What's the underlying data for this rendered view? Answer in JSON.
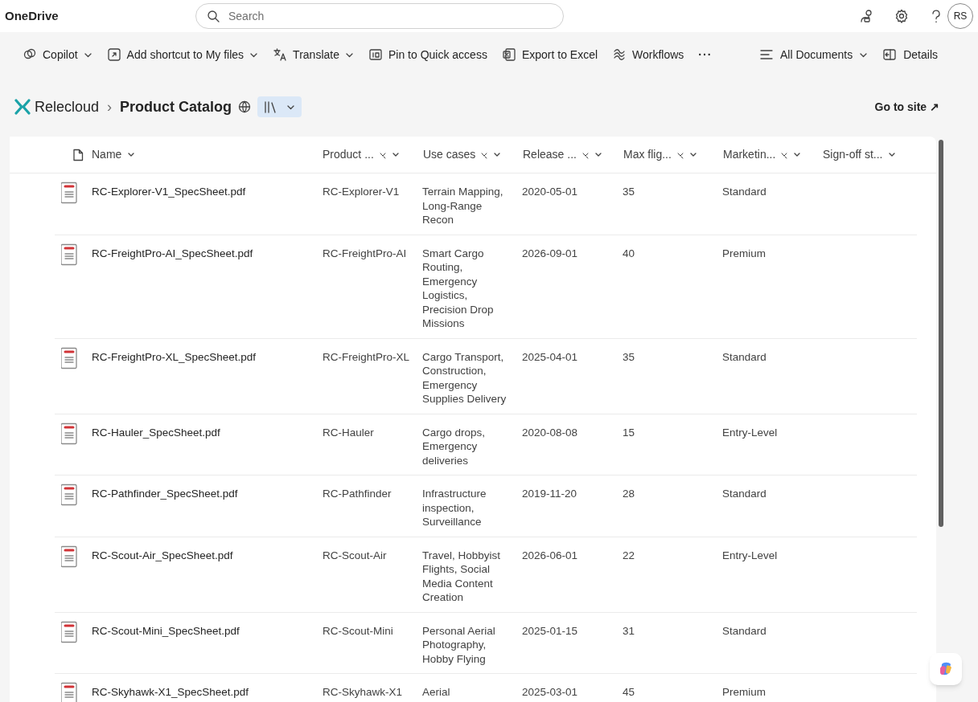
{
  "app": {
    "title": "OneDrive",
    "search_placeholder": "Search",
    "avatar": "RS"
  },
  "commands": [
    {
      "label": "Copilot",
      "kind": "copilot",
      "dropdown": true
    },
    {
      "label": "Add shortcut to My files",
      "kind": "shortcut",
      "dropdown": true
    },
    {
      "label": "Translate",
      "kind": "translate",
      "dropdown": true
    },
    {
      "label": "Pin to Quick access",
      "kind": "pin",
      "dropdown": false
    },
    {
      "label": "Export to Excel",
      "kind": "excel",
      "dropdown": false
    },
    {
      "label": "Workflows",
      "kind": "workflows",
      "dropdown": false
    }
  ],
  "more": "···",
  "view": {
    "label": "All Documents",
    "details": "Details"
  },
  "breadcrumb": {
    "site": "Relecloud",
    "separator": "›",
    "library": "Product Catalog"
  },
  "go_to_site": "Go to site ↗",
  "table": {
    "columns": [
      {
        "label": "Name",
        "filterable": false
      },
      {
        "label": "Product ...",
        "filterable": true
      },
      {
        "label": "Use cases",
        "filterable": true
      },
      {
        "label": "Release ...",
        "filterable": true
      },
      {
        "label": "Max flig...",
        "filterable": true
      },
      {
        "label": "Marketin...",
        "filterable": true
      },
      {
        "label": "Sign-off st...",
        "filterable": false
      }
    ],
    "rows": [
      {
        "name": "RC-Explorer-V1_SpecSheet.pdf",
        "product": "RC-Explorer-V1",
        "use_cases": "Terrain Mapping, Long-Range Recon",
        "release": "2020-05-01",
        "max_flight": "35",
        "marketing": "Standard"
      },
      {
        "name": "RC-FreightPro-AI_SpecSheet.pdf",
        "product": "RC-FreightPro-AI",
        "use_cases": "Smart Cargo Routing, Emergency Logistics, Precision Drop Missions",
        "release": "2026-09-01",
        "max_flight": "40",
        "marketing": "Premium"
      },
      {
        "name": "RC-FreightPro-XL_SpecSheet.pdf",
        "product": "RC-FreightPro-XL",
        "use_cases": "Cargo Transport, Construction, Emergency Supplies Delivery",
        "release": "2025-04-01",
        "max_flight": "35",
        "marketing": "Standard"
      },
      {
        "name": "RC-Hauler_SpecSheet.pdf",
        "product": "RC-Hauler",
        "use_cases": "Cargo drops, Emergency deliveries",
        "release": "2020-08-08",
        "max_flight": "15",
        "marketing": "Entry-Level"
      },
      {
        "name": "RC-Pathfinder_SpecSheet.pdf",
        "product": "RC-Pathfinder",
        "use_cases": "Infrastructure inspection, Surveillance",
        "release": "2019-11-20",
        "max_flight": "28",
        "marketing": "Standard"
      },
      {
        "name": "RC-Scout-Air_SpecSheet.pdf",
        "product": "RC-Scout-Air",
        "use_cases": "Travel, Hobbyist Flights, Social Media Content Creation",
        "release": "2026-06-01",
        "max_flight": "22",
        "marketing": "Entry-Level"
      },
      {
        "name": "RC-Scout-Mini_SpecSheet.pdf",
        "product": "RC-Scout-Mini",
        "use_cases": "Personal Aerial Photography, Hobby Flying",
        "release": "2025-01-15",
        "max_flight": "31",
        "marketing": "Standard"
      },
      {
        "name": "RC-Skyhawk-X1_SpecSheet.pdf",
        "product": "RC-Skyhawk-X1",
        "use_cases": "Aerial",
        "release": "2025-03-01",
        "max_flight": "45",
        "marketing": "Premium"
      }
    ]
  }
}
